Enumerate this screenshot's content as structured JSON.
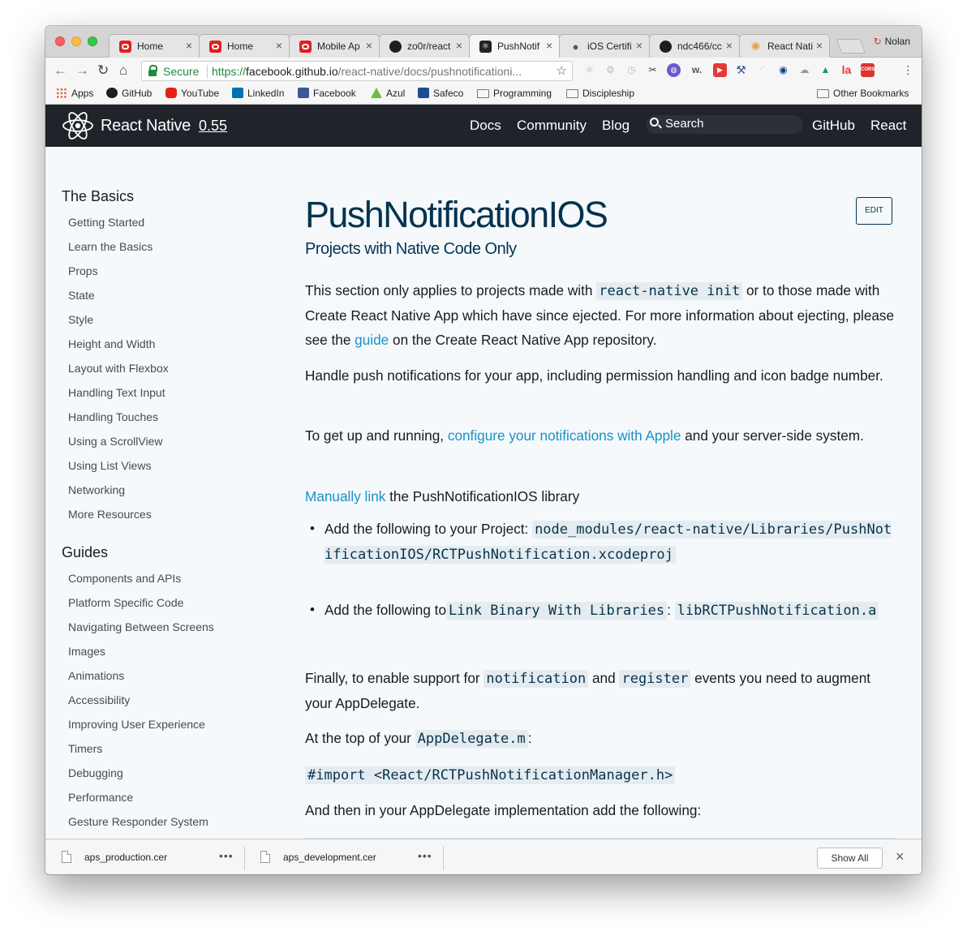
{
  "browser": {
    "tabs": [
      {
        "label": "Home",
        "icon": "oracle-icon"
      },
      {
        "label": "Home",
        "icon": "oracle-icon"
      },
      {
        "label": "Mobile Ap",
        "icon": "oracle-icon"
      },
      {
        "label": "zo0r/react",
        "icon": "github-icon"
      },
      {
        "label": "PushNotif",
        "icon": "react-native-icon"
      },
      {
        "label": "iOS Certifi",
        "icon": "apple-icon"
      },
      {
        "label": "ndc466/cc",
        "icon": "github-icon"
      },
      {
        "label": "React Nati",
        "icon": "react-native-web-icon"
      }
    ],
    "tab_close_glyph": "×",
    "profile_name": "Nolan",
    "omnibox": {
      "secure_label": "Secure",
      "url_scheme": "https://",
      "url_host": "facebook.github.io",
      "url_path": "/react-native/docs/pushnotificationi..."
    },
    "bookmarks": [
      {
        "label": "Apps",
        "icon": "apps-icon"
      },
      {
        "label": "GitHub",
        "icon": "github-icon"
      },
      {
        "label": "YouTube",
        "icon": "youtube-icon"
      },
      {
        "label": "LinkedIn",
        "icon": "linkedin-icon"
      },
      {
        "label": "Facebook",
        "icon": "facebook-icon"
      },
      {
        "label": "Azul",
        "icon": "azul-icon"
      },
      {
        "label": "Safeco",
        "icon": "safeco-icon"
      },
      {
        "label": "Programming",
        "icon": "folder-icon"
      },
      {
        "label": "Discipleship",
        "icon": "folder-icon"
      }
    ],
    "other_bookmarks": "Other Bookmarks",
    "extension_badge": "w.",
    "extension_la": "la",
    "extension_cors": "CORS"
  },
  "site": {
    "brand": "React Native",
    "version": "0.55",
    "nav": {
      "docs": "Docs",
      "community": "Community",
      "blog": "Blog",
      "search_placeholder": "Search",
      "github": "GitHub",
      "react": "React"
    }
  },
  "sidebar": {
    "basics_heading": "The Basics",
    "basics": [
      "Getting Started",
      "Learn the Basics",
      "Props",
      "State",
      "Style",
      "Height and Width",
      "Layout with Flexbox",
      "Handling Text Input",
      "Handling Touches",
      "Using a ScrollView",
      "Using List Views",
      "Networking",
      "More Resources"
    ],
    "guides_heading": "Guides",
    "guides": [
      "Components and APIs",
      "Platform Specific Code",
      "Navigating Between Screens",
      "Images",
      "Animations",
      "Accessibility",
      "Improving User Experience",
      "Timers",
      "Debugging",
      "Performance",
      "Gesture Responder System"
    ]
  },
  "article": {
    "title": "PushNotificationIOS",
    "subtitle": "Projects with Native Code Only",
    "edit_label": "EDIT",
    "p1_a": "This section only applies to projects made with",
    "p1_code": "react-native init",
    "p1_b": "or to those made with Create React Native App which have since ejected. For more information about ejecting, please see the",
    "p1_link": "guide",
    "p1_c": "on the Create React Native App repository.",
    "p2": "Handle push notifications for your app, including permission handling and icon badge number.",
    "p3_a": "To get up and running,",
    "p3_link": "configure your notifications with Apple",
    "p3_b": "and your server-side system.",
    "p4_link": "Manually link",
    "p4_b": "the PushNotificationIOS library",
    "li1_a": "Add the following to your Project:",
    "li1_code": "node_modules/react-native/Libraries/PushNotificationIOS/RCTPushNotification.xcodeproj",
    "li2_a": "Add the following to",
    "li2_code1": "Link Binary With Libraries",
    "li2_colon": ":",
    "li2_code2": "libRCTPushNotification.a",
    "p5_a": "Finally, to enable support for",
    "p5_code1": "notification",
    "p5_and": "and",
    "p5_code2": "register",
    "p5_b": "events you need to augment your AppDelegate.",
    "p6_a": "At the top of your",
    "p6_code": "AppDelegate.m",
    "p6_colon": ":",
    "p7_code": "#import <React/RCTPushNotificationManager.h>",
    "p8": "And then in your AppDelegate implementation add the following:"
  },
  "downloads": {
    "items": [
      "aps_production.cer",
      "aps_development.cer"
    ],
    "more_glyph": "•••",
    "show_all": "Show All",
    "close_glyph": "×"
  }
}
